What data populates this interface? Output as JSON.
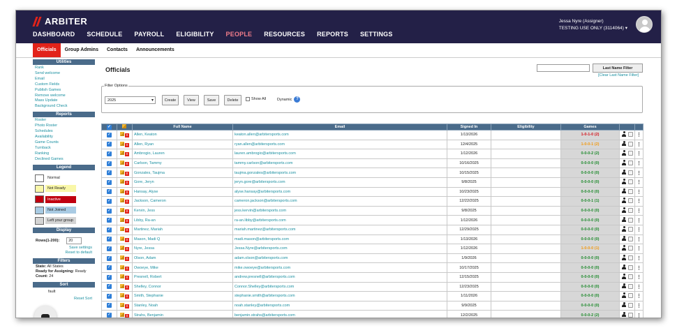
{
  "brand": "ARBITER",
  "nav": [
    "DASHBOARD",
    "SCHEDULE",
    "PAYROLL",
    "ELIGIBILITY",
    "PEOPLE",
    "RESOURCES",
    "REPORTS",
    "SETTINGS"
  ],
  "nav_active": "PEOPLE",
  "user": {
    "name": "Jessa Nyre (Assigner)",
    "org": "TESTING USE ONLY (3114064) ▾"
  },
  "subnav": [
    "Officials",
    "Group Admins",
    "Contacts",
    "Announcements"
  ],
  "sidebar": {
    "utilities_title": "Utilities",
    "utilities": [
      "Rank",
      "Send welcome",
      "Email",
      "Custom Fields",
      "Publish Games",
      "Remove welcome",
      "Mass Update",
      "Background Check"
    ],
    "reports_title": "Reports",
    "reports": [
      "Roster",
      "Photo Roster",
      "Schedules",
      "Availability",
      "Game Counts",
      "Turnback",
      "Ranking",
      "Declined Games"
    ],
    "legend_title": "Legend",
    "legend": [
      {
        "label": "Normal",
        "bg": "#ffffff",
        "box": "#ffffff"
      },
      {
        "label": "Not Ready",
        "bg": "#f9f7a8",
        "box": "#f9f7a8"
      },
      {
        "label": "Inactive",
        "bg": "#c0000f",
        "box": "#c0000f",
        "fg": "#ffffff"
      },
      {
        "label": "Not Joined",
        "bg": "#a9cbe3",
        "box": "#a9cbe3"
      },
      {
        "label": "Left your group",
        "bg": "#d4d4d4",
        "box": "#d4d4d4"
      }
    ],
    "display_title": "Display",
    "rows_label": "Rows(1-200):",
    "rows_value": "20",
    "save_settings": "Save settings",
    "reset_default": "Reset to default",
    "filters_title": "Filters",
    "state_label": "State:",
    "state_value": "All States",
    "ready_label": "Ready for Assigning:",
    "ready_value": "Ready",
    "count_label": "Count:",
    "count_value": "24",
    "sort_title": "Sort",
    "sort_text": "fault",
    "reset_sort": "Reset Sort"
  },
  "main": {
    "title": "Officials",
    "last_name_filter": "Last Name Filter",
    "clear_filter": "[Clear Last Name Filter]",
    "filter_options": "Filter Options",
    "season": "2025",
    "buttons": [
      "Create",
      "View",
      "Save",
      "Delete"
    ],
    "show_all": "Show All",
    "dynamic": "Dynamic",
    "columns": [
      "Full Name",
      "Email",
      "Signed In",
      "Eligibility",
      "Games"
    ]
  },
  "rows": [
    {
      "name": "Allen, Keaton",
      "email": "keaton.allen@arbitersports.com",
      "signed": "1/13/2026",
      "games": "1-0-1-0 (2)",
      "gc": "red"
    },
    {
      "name": "Allen, Ryan",
      "email": "ryan.allen@arbitersports.com",
      "signed": "12/4/2025",
      "games": "1-0-0-1 (2)",
      "gc": "orange"
    },
    {
      "name": "Ambrogio, Lauren",
      "email": "lauren.ambrogio@arbitersports.com",
      "signed": "1/12/2026",
      "games": "0-0-0-2 (2)",
      "gc": "green"
    },
    {
      "name": "Carlson, Tammy",
      "email": "tammy.carlson@arbitersports.com",
      "signed": "10/16/2025",
      "games": "0-0-0-0 (0)",
      "gc": "green"
    },
    {
      "name": "Gonzales, Taujma",
      "email": "taujma.gonzales@arbitersports.com",
      "signed": "10/15/2025",
      "games": "0-0-0-0 (0)",
      "gc": "green"
    },
    {
      "name": "Gore, Jeryn",
      "email": "jeryn.gore@arbitersports.com",
      "signed": "9/8/2025",
      "games": "0-0-0-0 (0)",
      "gc": "green"
    },
    {
      "name": "Hansay, Alyse",
      "email": "alyse.hansay@arbitersports.com",
      "signed": "10/23/2025",
      "games": "0-0-0-0 (0)",
      "gc": "green"
    },
    {
      "name": "Jackson, Cameron",
      "email": "cameron.jackson@arbitersports.com",
      "signed": "12/22/2025",
      "games": "0-0-0-1 (1)",
      "gc": "green"
    },
    {
      "name": "Kervin, Jess",
      "email": "jess.kervin@arbitersports.com",
      "signed": "9/8/2025",
      "games": "0-0-0-0 (0)",
      "gc": "green"
    },
    {
      "name": "Libby, Ra-an",
      "email": "ra-an.libby@arbitersports.com",
      "signed": "1/12/2026",
      "games": "0-0-0-0 (0)",
      "gc": "green"
    },
    {
      "name": "Martinez, Mariah",
      "email": "mariah.martinez@arbitersports.com",
      "signed": "12/29/2025",
      "games": "0-0-0-0 (0)",
      "gc": "green"
    },
    {
      "name": "Mason, Madi Q",
      "email": "madi.mason@arbitersports.com",
      "signed": "1/13/2026",
      "games": "0-0-0-0 (0)",
      "gc": "green"
    },
    {
      "name": "Nyre, Jessa",
      "email": "Jessa.Nyre@arbitersports.com",
      "signed": "1/12/2026",
      "games": "1-0-0-0 (1)",
      "gc": "orange"
    },
    {
      "name": "Olson, Adam",
      "email": "adam.olson@arbitersports.com",
      "signed": "1/9/2026",
      "games": "0-0-0-0 (0)",
      "gc": "green"
    },
    {
      "name": "Owoeye, Mike",
      "email": "mike.owoeye@arbitersports.com",
      "signed": "10/17/2025",
      "games": "0-0-0-0 (0)",
      "gc": "green"
    },
    {
      "name": "Presnell, Robert",
      "email": "andrew.presnell@arbitersports.com",
      "signed": "12/15/2025",
      "games": "0-0-0-0 (0)",
      "gc": "green"
    },
    {
      "name": "Shelley, Connor",
      "email": "Connor.Shelley@arbitersports.com",
      "signed": "12/23/2025",
      "games": "0-0-0-0 (0)",
      "gc": "green"
    },
    {
      "name": "Smith, Stephanie",
      "email": "stephanie.smith@arbitersports.com",
      "signed": "1/11/2026",
      "games": "0-0-0-0 (0)",
      "gc": "green"
    },
    {
      "name": "Stanley, Noah",
      "email": "noah.stanley@arbitersports.com",
      "signed": "9/9/2025",
      "games": "0-0-0-0 (0)",
      "gc": "green"
    },
    {
      "name": "Strahs, Benjamin",
      "email": "benjamin.strahs@arbitersports.com",
      "signed": "12/2/2025",
      "games": "0-0-0-2 (2)",
      "gc": "green"
    }
  ]
}
